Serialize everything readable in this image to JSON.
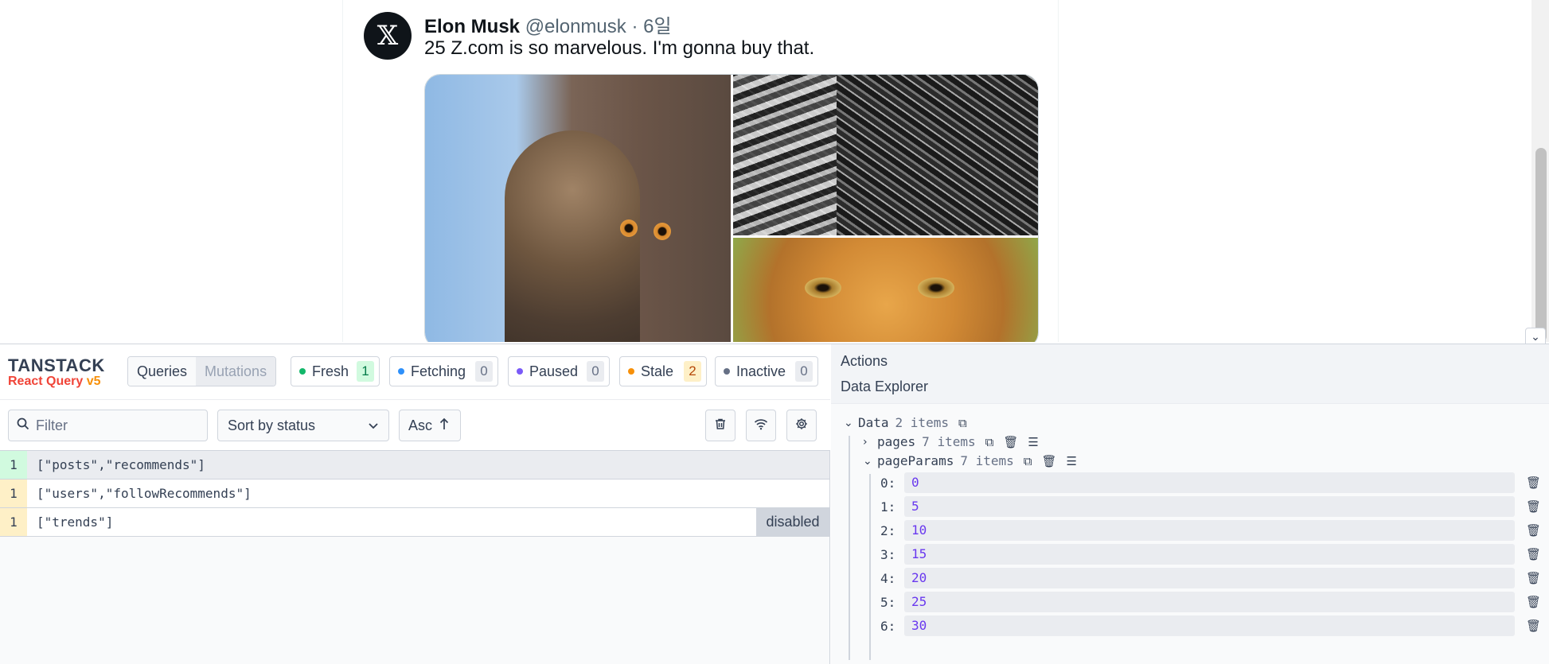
{
  "post": {
    "avatar_glyph": "𝕏",
    "name": "Elon Musk",
    "handle": "@elonmusk",
    "separator": "·",
    "time": "6일",
    "text": "25 Z.com is so marvelous. I'm gonna buy that."
  },
  "devtools": {
    "logo_line1": "TANSTACK",
    "logo_line2": "React Query",
    "logo_version": "v5",
    "tabs": {
      "queries": "Queries",
      "mutations": "Mutations"
    },
    "statuses": [
      {
        "label": "Fresh",
        "count": "1",
        "dot": "#12b76a",
        "bg": "#d1fadf",
        "fg": "#027a48"
      },
      {
        "label": "Fetching",
        "count": "0",
        "dot": "#2e90fa",
        "bg": "#eaecf0",
        "fg": "#667085"
      },
      {
        "label": "Paused",
        "count": "0",
        "dot": "#7a5af8",
        "bg": "#eaecf0",
        "fg": "#667085"
      },
      {
        "label": "Stale",
        "count": "2",
        "dot": "#f79009",
        "bg": "#fef0c7",
        "fg": "#b54708"
      },
      {
        "label": "Inactive",
        "count": "0",
        "dot": "#667085",
        "bg": "#eaecf0",
        "fg": "#667085"
      }
    ],
    "filter_placeholder": "Filter",
    "sort_label": "Sort by status",
    "order_label": "Asc",
    "queries": [
      {
        "count": "1",
        "key": "[\"posts\",\"recommends\"]",
        "color": "#d1fadf",
        "badge": ""
      },
      {
        "count": "1",
        "key": "[\"users\",\"followRecommends\"]",
        "color": "#fef0c7",
        "badge": ""
      },
      {
        "count": "1",
        "key": "[\"trends\"]",
        "color": "#fef0c7",
        "badge": "disabled"
      }
    ],
    "actions_label": "Actions",
    "explorer_label": "Data Explorer",
    "tree": {
      "root_label": "Data",
      "root_meta": "2 items",
      "pages_label": "pages",
      "pages_meta": "7 items",
      "params_label": "pageParams",
      "params_meta": "7 items",
      "params": [
        {
          "index": "0:",
          "value": "0"
        },
        {
          "index": "1:",
          "value": "5"
        },
        {
          "index": "2:",
          "value": "10"
        },
        {
          "index": "3:",
          "value": "15"
        },
        {
          "index": "4:",
          "value": "20"
        },
        {
          "index": "5:",
          "value": "25"
        },
        {
          "index": "6:",
          "value": "30"
        }
      ]
    }
  }
}
